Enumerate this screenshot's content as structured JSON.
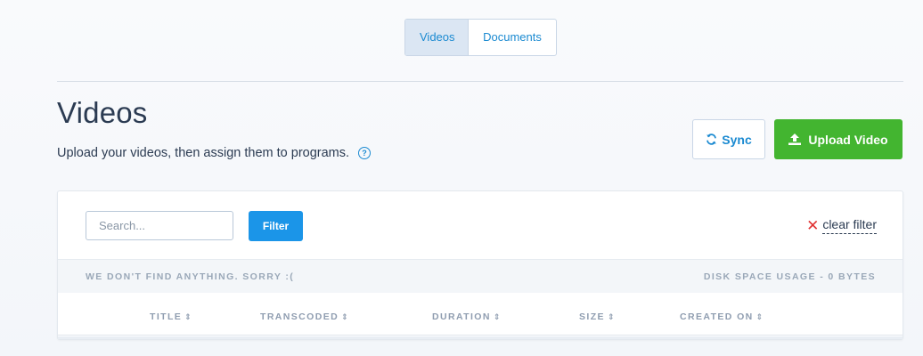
{
  "tabs": [
    {
      "label": "Videos",
      "active": true
    },
    {
      "label": "Documents",
      "active": false
    }
  ],
  "header": {
    "title": "Videos",
    "subtitle": "Upload your videos, then assign them to programs.",
    "help_icon": "question-circle-icon"
  },
  "actions": {
    "sync_label": "Sync",
    "sync_icon": "refresh-icon",
    "upload_label": "Upload Video",
    "upload_icon": "upload-icon",
    "upload_color": "#43b530",
    "accent_color": "#1b8ad1"
  },
  "filter": {
    "search_placeholder": "Search...",
    "search_value": "",
    "filter_label": "Filter",
    "clear_label": "clear filter",
    "clear_icon": "x-icon",
    "clear_icon_color": "#e03131"
  },
  "status": {
    "empty_message": "WE DON'T FIND ANYTHING. SORRY :(",
    "disk_usage": "DISK SPACE USAGE - 0 BYTES"
  },
  "table": {
    "columns": [
      {
        "label": "TITLE"
      },
      {
        "label": "TRANSCODED"
      },
      {
        "label": "DURATION"
      },
      {
        "label": "SIZE"
      },
      {
        "label": "CREATED ON"
      }
    ],
    "sort_icon": "sort-icon",
    "rows": []
  }
}
